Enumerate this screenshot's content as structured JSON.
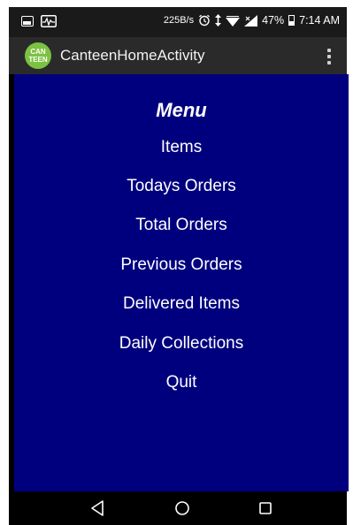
{
  "status_bar": {
    "speed": "225B/s",
    "battery_percent": "47%",
    "time": "7:14 AM"
  },
  "app": {
    "icon_text_top": "CAN",
    "icon_text_bottom": "TEEN",
    "title": "CanteenHomeActivity"
  },
  "menu": {
    "title": "Menu",
    "items": [
      {
        "label": "Items"
      },
      {
        "label": "Todays Orders"
      },
      {
        "label": "Total Orders"
      },
      {
        "label": "Previous Orders"
      },
      {
        "label": "Delivered Items"
      },
      {
        "label": "Daily Collections"
      },
      {
        "label": "Quit"
      }
    ]
  },
  "icons": {
    "status_left": [
      "image-icon",
      "activity-icon"
    ],
    "status_right": [
      "alarm-icon",
      "data-arrows-icon",
      "wifi-icon",
      "signal-icon",
      "battery-icon"
    ],
    "nav": [
      "back-icon",
      "home-icon",
      "recents-icon"
    ]
  },
  "colors": {
    "content_background": "#00007f",
    "app_icon": "#7cc242",
    "action_bar": "#2a2a2a",
    "status_bar": "#1a1a1a"
  }
}
